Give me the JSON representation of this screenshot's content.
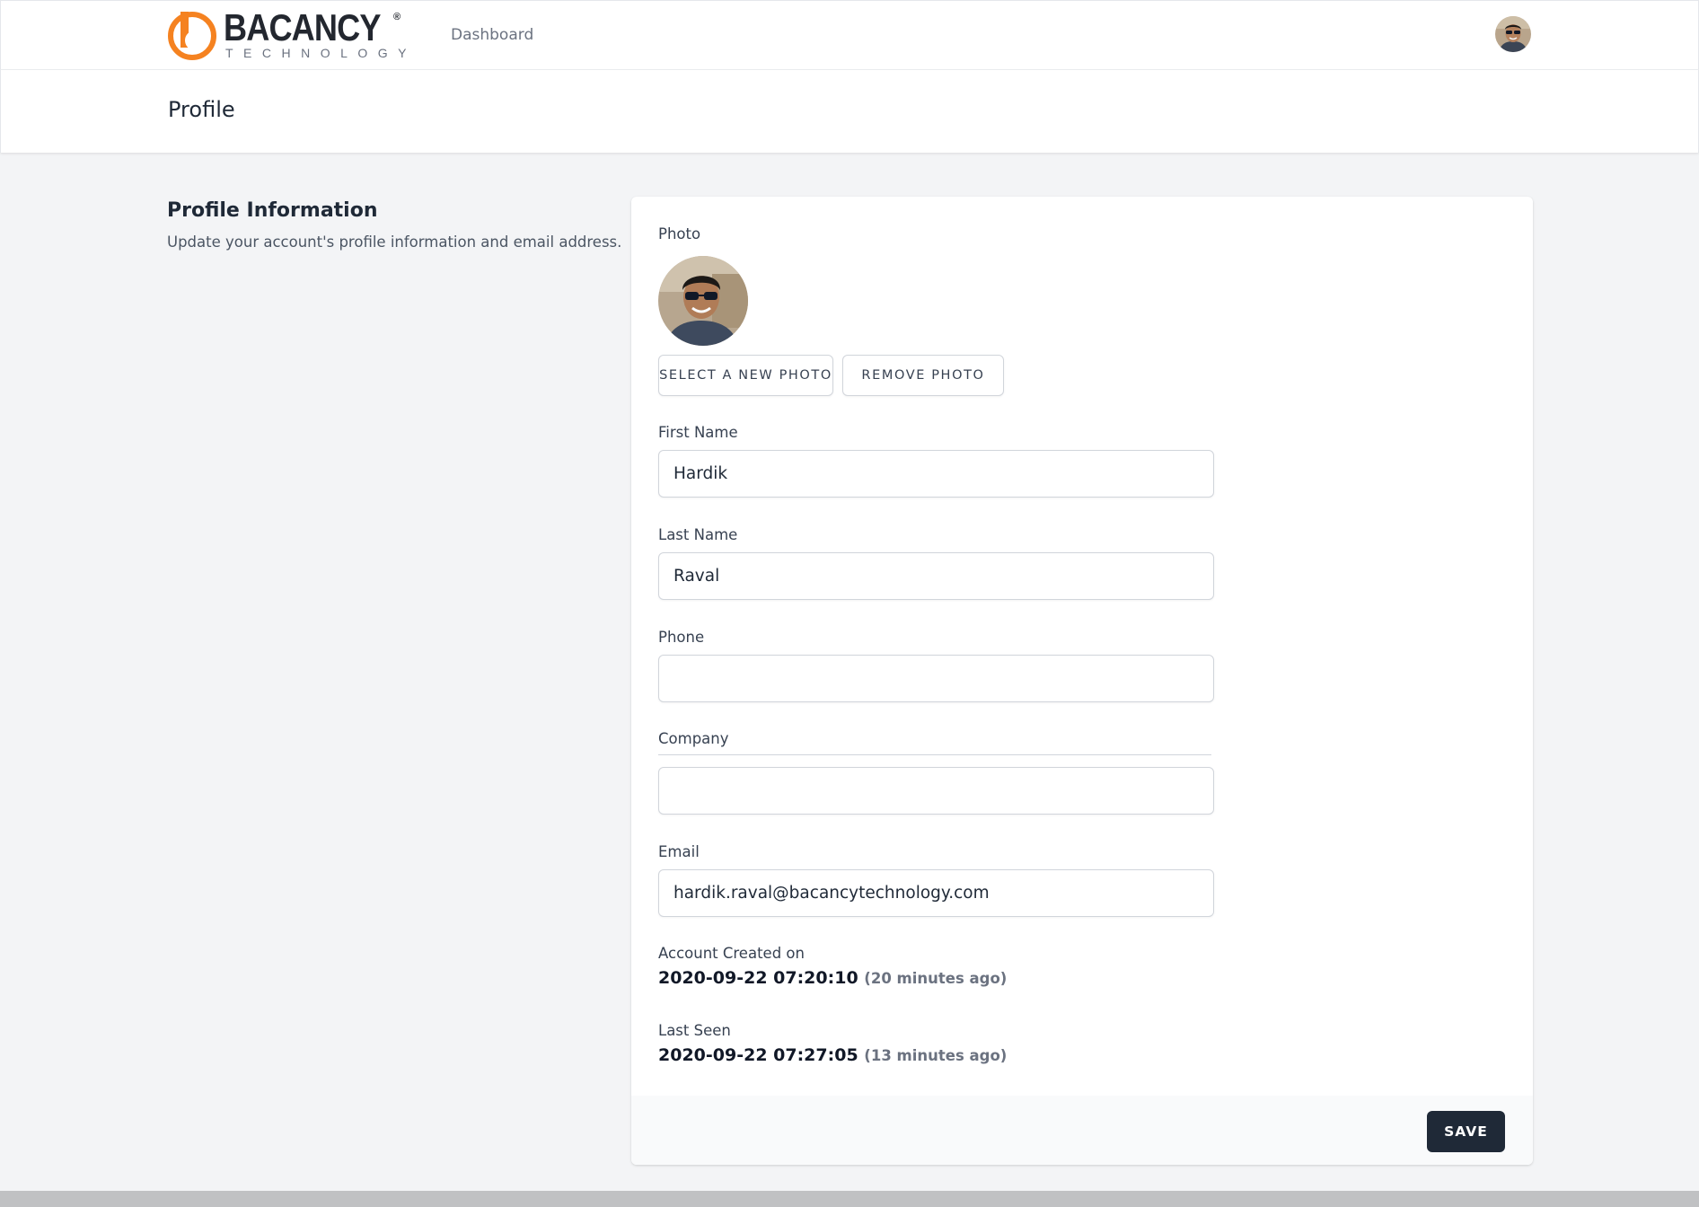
{
  "brand": {
    "name": "BACANCY",
    "registered": "®",
    "tagline": "TECHNOLOGY",
    "color": "#f58220"
  },
  "nav": {
    "dashboard_label": "Dashboard"
  },
  "header": {
    "title": "Profile"
  },
  "section": {
    "title": "Profile Information",
    "description": "Update your account's profile information and email address."
  },
  "form": {
    "photo_label": "Photo",
    "select_photo_label": "SELECT A NEW PHOTO",
    "remove_photo_label": "REMOVE PHOTO",
    "first_name_label": "First Name",
    "first_name_value": "Hardik",
    "last_name_label": "Last Name",
    "last_name_value": "Raval",
    "phone_label": "Phone",
    "phone_value": "",
    "company_label": "Company",
    "company_value": "",
    "email_label": "Email",
    "email_value": "hardik.raval@bacancytechnology.com",
    "account_created_label": "Account Created on",
    "account_created_value": "2020-09-22 07:20:10",
    "account_created_relative": "(20 minutes ago)",
    "last_seen_label": "Last Seen",
    "last_seen_value": "2020-09-22 07:27:05",
    "last_seen_relative": "(13 minutes ago)",
    "save_label": "SAVE"
  },
  "colors": {
    "accent": "#1f2937",
    "page_bg": "#f3f4f6"
  }
}
